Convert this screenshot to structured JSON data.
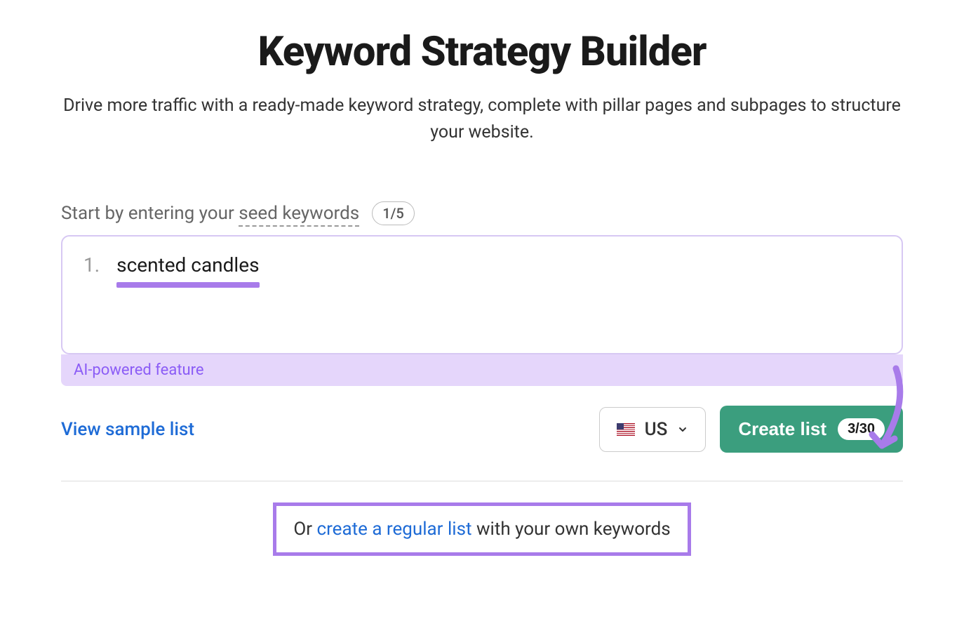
{
  "title": "Keyword Strategy Builder",
  "subtitle": "Drive more traffic with a ready-made keyword strategy, complete with pillar pages and subpages to structure your website.",
  "prompt": {
    "prefix": "Start by entering your ",
    "seed_label": "seed keywords",
    "count": "1/5"
  },
  "keywords": [
    {
      "num": "1.",
      "text": "scented candles"
    }
  ],
  "ai_feature_label": "AI-powered feature",
  "view_sample_label": "View sample list",
  "country": {
    "code": "US"
  },
  "create_button": {
    "label": "Create list",
    "badge": "3/30"
  },
  "alt": {
    "prefix": "Or ",
    "link": "create a regular list",
    "suffix": " with your own keywords"
  }
}
